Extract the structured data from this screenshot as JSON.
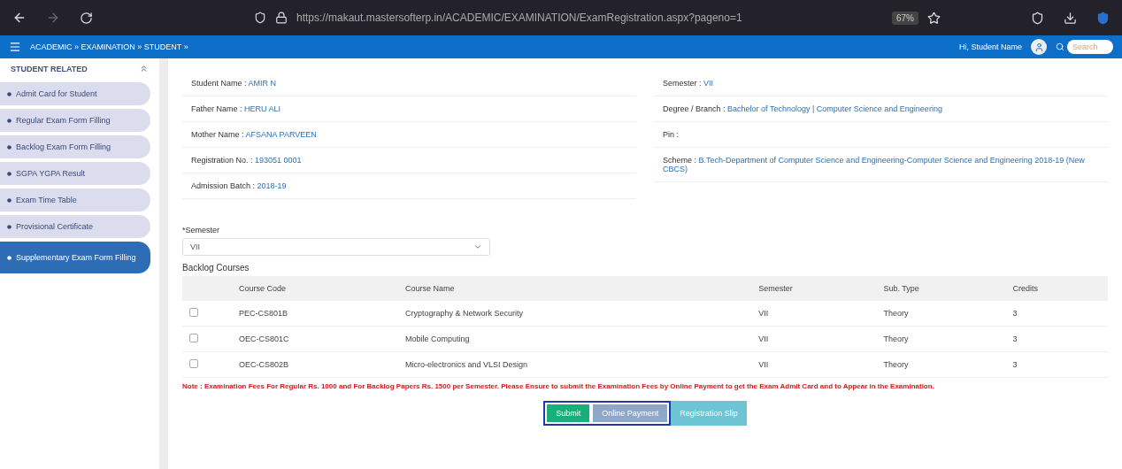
{
  "browser": {
    "url": "https://makaut.mastersofterp.in/ACADEMIC/EXAMINATION/ExamRegistration.aspx?pageno=1",
    "zoom": "67%"
  },
  "navbar": {
    "breadcrumb": "ACADEMIC » EXAMINATION » STUDENT »",
    "user": "Hi, Student Name",
    "search": {
      "placeholder": "Search"
    }
  },
  "sidebar": {
    "title": "STUDENT RELATED",
    "items": [
      {
        "label": "Admit Card for Student",
        "selected": false
      },
      {
        "label": "Regular Exam Form Filling",
        "selected": false
      },
      {
        "label": "Backlog Exam Form Filling",
        "selected": false
      },
      {
        "label": "SGPA YGPA Result",
        "selected": false
      },
      {
        "label": "Exam Time Table",
        "selected": false
      },
      {
        "label": "Provisional Certificate",
        "selected": false
      },
      {
        "label": "Supplementary Exam Form Filling",
        "selected": true
      }
    ]
  },
  "student_info": {
    "left": [
      {
        "label": "Student Name :",
        "value": "AMIR N"
      },
      {
        "label": "Father Name :",
        "value": "HERU ALI"
      },
      {
        "label": "Mother Name :",
        "value": "AFSANA PARVEEN"
      },
      {
        "label": "Registration No. :",
        "value": "193051 0001"
      },
      {
        "label": "Admission Batch :",
        "value": "2018-19"
      }
    ],
    "right": [
      {
        "label": "Semester :",
        "value": "VII"
      },
      {
        "label": "Degree / Branch :",
        "value": "Bachelor of Technology | Computer Science and Engineering"
      },
      {
        "label": "Pin :"
      },
      {
        "label": "Scheme :",
        "value": "B.Tech-Department of Computer Science and Engineering-Computer Science and Engineering 2018-19 (New CBCS)"
      }
    ]
  },
  "semester_select": {
    "label": "*Semester",
    "value": "VII"
  },
  "backlog": {
    "title": "Backlog Courses",
    "columns": [
      "Course Code",
      "Course Name",
      "Semester",
      "Sub. Type",
      "Credits"
    ],
    "rows": [
      {
        "checked": false,
        "cells": [
          "PEC-CS801B",
          "Cryptography & Network Security",
          "VII",
          "Theory",
          "3"
        ]
      },
      {
        "checked": false,
        "cells": [
          "OEC-CS801C",
          "Mobile Computing",
          "VII",
          "Theory",
          "3"
        ]
      },
      {
        "checked": false,
        "cells": [
          "OEC-CS802B",
          "Micro-electronics and VLSI Design",
          "VII",
          "Theory",
          "3"
        ]
      }
    ]
  },
  "note": "Note : Examination Fees For Regular Rs. 1000 and For Backlog Papers Rs. 1500 per Semester. Please Ensure to submit the Examination Fees by Online Payment to get the Exam Admit Card and to Appear in the Examination.",
  "buttons": [
    {
      "label": "Submit",
      "kind": "primary"
    },
    {
      "label": "Online Payment",
      "kind": "secondary"
    },
    {
      "label": "Registration Slip",
      "kind": "info"
    }
  ]
}
